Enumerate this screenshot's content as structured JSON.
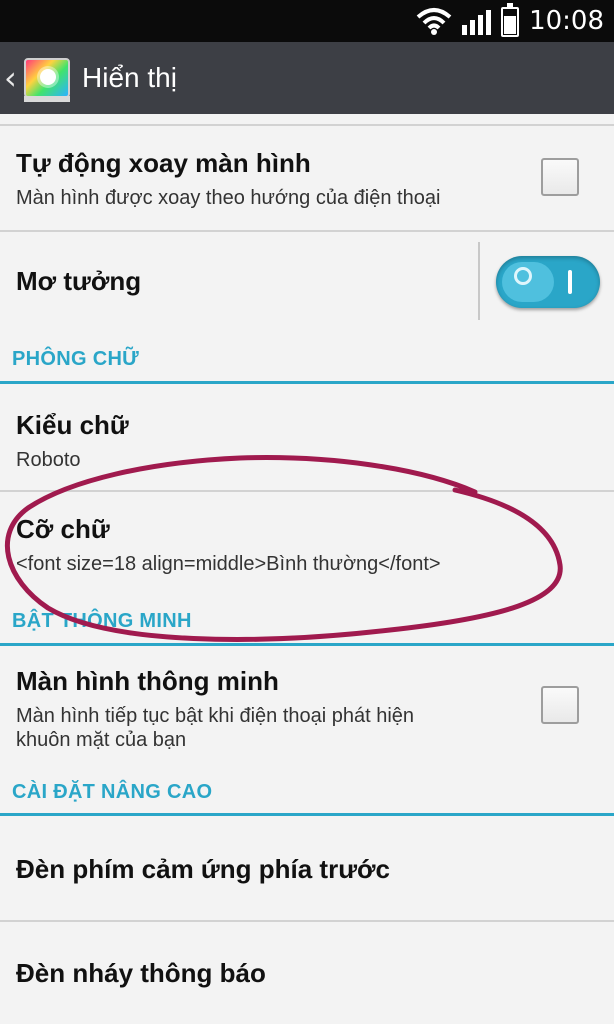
{
  "status_bar": {
    "time": "10:08",
    "icons": [
      "wifi-icon",
      "signal-icon",
      "battery-icon"
    ]
  },
  "action_bar": {
    "title": "Hiển thị",
    "app_icon": "display-settings-icon"
  },
  "settings": {
    "auto_rotate": {
      "title": "Tự động xoay màn hình",
      "summary": "Màn hình được xoay theo hướng của điện thoại",
      "checked": false
    },
    "daydream": {
      "title": "Mơ tưởng",
      "enabled": true
    },
    "font_section": {
      "header": "PHÔNG CHỮ"
    },
    "font_type": {
      "title": "Kiểu chữ",
      "summary": "Roboto"
    },
    "font_size": {
      "title": "Cỡ chữ",
      "summary": "<font size=18 align=middle>Bình thường</font>"
    },
    "smart_section": {
      "header": "BẬT THÔNG MINH"
    },
    "smart_screen": {
      "title": "Màn hình thông minh",
      "summary_line1": "Màn hình tiếp tục bật khi điện thoại phát hiện",
      "summary_line2": "khuôn mặt của bạn",
      "checked": false
    },
    "advanced_section": {
      "header": "CÀI ĐẶT NÂNG CAO"
    },
    "front_touch_light": {
      "title": "Đèn phím cảm ứng phía trước"
    },
    "notification_flash": {
      "title": "Đèn nháy thông báo"
    }
  },
  "colors": {
    "accent": "#2aa6c8",
    "action_bar": "#3d3f45",
    "status_bar": "#0b0b0b",
    "annotation_ink": "#a01a4e"
  }
}
